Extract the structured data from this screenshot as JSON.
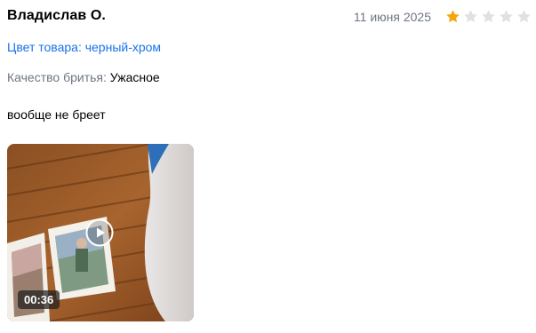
{
  "review": {
    "author": "Владислав О.",
    "date": "11 июня 2025",
    "rating": 1,
    "rating_max": 5,
    "variant": "Цвет товара: черный-хром",
    "quality_label": "Качество бритья:",
    "quality_value": "Ужасное",
    "comment": "вообще не бреет",
    "video_duration": "00:36"
  },
  "colors": {
    "star_filled": "#f6a609",
    "star_empty": "#dfe1e5",
    "link": "#1a73e8",
    "muted": "#6e7682"
  },
  "icons": {
    "star": "star-icon",
    "play": "play-icon"
  }
}
